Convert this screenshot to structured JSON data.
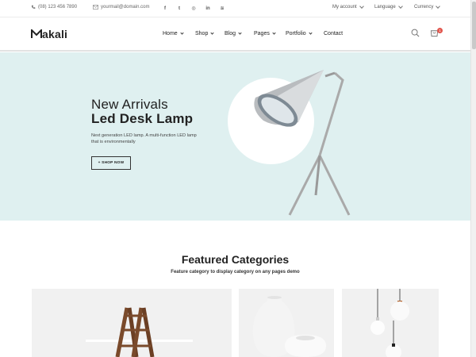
{
  "topbar": {
    "phone": "(08) 123 456 7890",
    "email": "yourmail@domain.com",
    "social": [
      {
        "icon": "facebook-icon",
        "glyph": "f"
      },
      {
        "icon": "twitter-icon",
        "glyph": "t"
      },
      {
        "icon": "instagram-icon",
        "glyph": "◎"
      },
      {
        "icon": "linkedin-icon",
        "glyph": "in"
      },
      {
        "icon": "rss-icon",
        "glyph": "≋"
      }
    ],
    "my_account": "My account",
    "language": "Language",
    "currency": "Currency"
  },
  "header": {
    "logo_text": "akali",
    "nav": [
      "Home",
      "Shop",
      "Blog",
      "Pages",
      "Portfolio",
      "Contact"
    ],
    "cart_count": "1"
  },
  "hero": {
    "title_line1": "New Arrivals",
    "title_line2": "Led Desk Lamp",
    "description": "Next generation LED lamp. A multi-function LED lamp that is environmentally",
    "button_label": "+ SHOP NOW",
    "bg_color": "#dff0f0"
  },
  "featured": {
    "title": "Featured Categories",
    "subtitle": "Feature category to display category on any pages demo"
  },
  "colors": {
    "accent": "#e2564d",
    "text": "#222222"
  }
}
